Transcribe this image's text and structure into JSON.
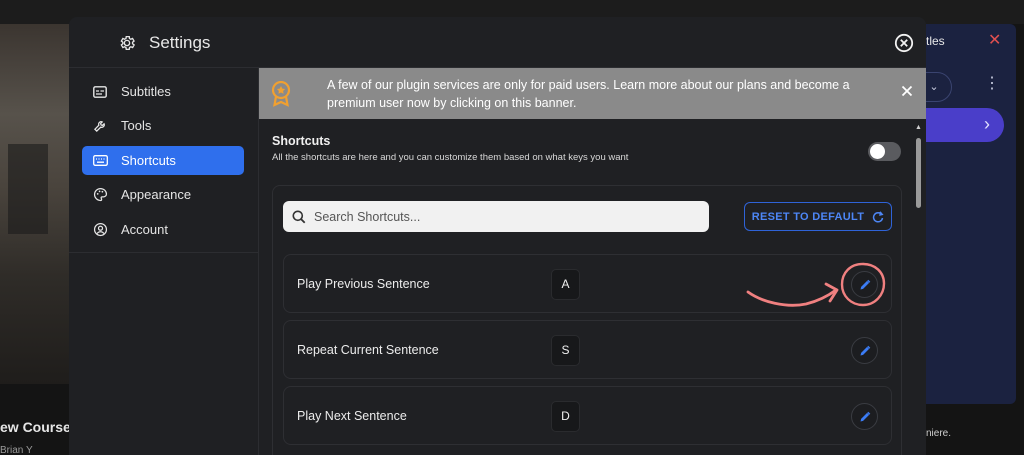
{
  "background": {
    "course_title": "ew Course",
    "course_sub": "Brian Y",
    "panel_title": "tles",
    "panel_dots": "⋮",
    "panel_footer": "niere."
  },
  "modal": {
    "title": "Settings"
  },
  "sidebar": {
    "items": [
      {
        "label": "Subtitles",
        "icon": "subtitles-icon",
        "active": false
      },
      {
        "label": "Tools",
        "icon": "wrench-icon",
        "active": false
      },
      {
        "label": "Shortcuts",
        "icon": "keyboard-icon",
        "active": true
      },
      {
        "label": "Appearance",
        "icon": "palette-icon",
        "active": false
      },
      {
        "label": "Account",
        "icon": "account-icon",
        "active": false
      }
    ]
  },
  "banner": {
    "text": "A few of our plugin services are only for paid users. Learn more about our plans and become a premium user now by clicking on this banner.",
    "icon": "premium-badge-icon"
  },
  "shortcuts": {
    "title": "Shortcuts",
    "description": "All the shortcuts are here and you can customize them based on what keys you want",
    "toggle_on": false,
    "search_placeholder": "Search Shortcuts...",
    "reset_label": "RESET TO DEFAULT",
    "rows": [
      {
        "name": "Play Previous Sentence",
        "key": "A"
      },
      {
        "name": "Repeat Current Sentence",
        "key": "S"
      },
      {
        "name": "Play Next Sentence",
        "key": "D"
      }
    ]
  },
  "colors": {
    "accent": "#2f6fed",
    "banner_bg": "#8a8a8a",
    "badge": "#f0a030",
    "annotation": "#f08080"
  }
}
